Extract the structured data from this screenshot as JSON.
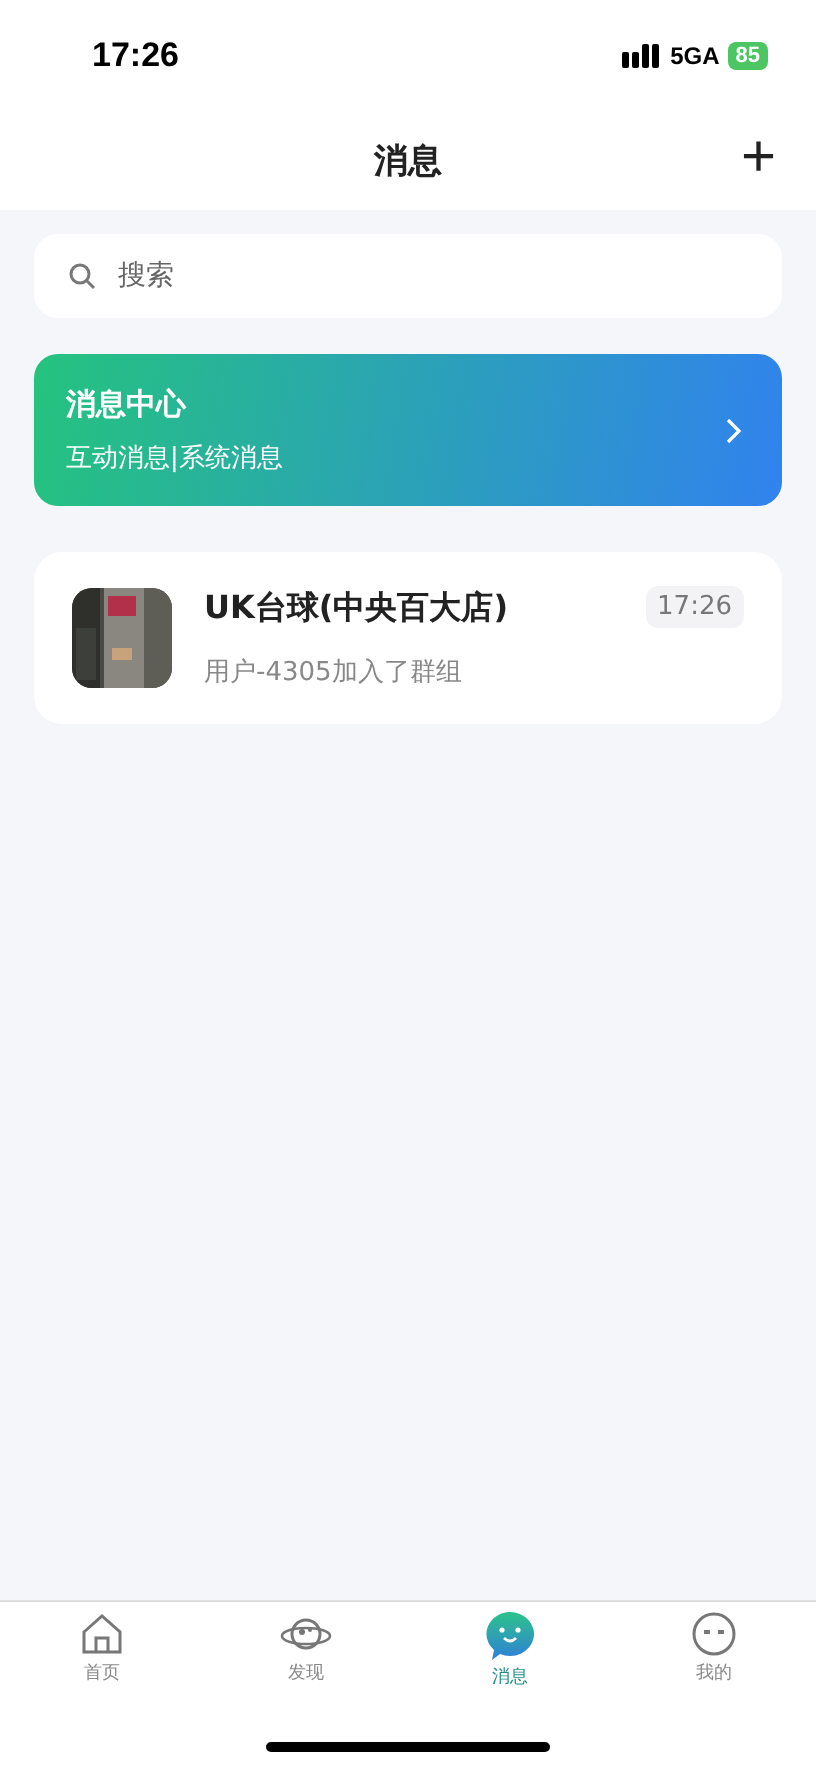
{
  "status_bar": {
    "time": "17:26",
    "network": "5GA",
    "battery": "85"
  },
  "nav": {
    "title": "消息",
    "add": "+"
  },
  "search": {
    "placeholder": "搜索"
  },
  "message_center": {
    "title": "消息中心",
    "subtitle": "互动消息|系统消息"
  },
  "chats": [
    {
      "name": "UK台球(中央百大店)",
      "preview": "用户-4305加入了群组",
      "time": "17:26"
    }
  ],
  "tabs": [
    {
      "kind": "home",
      "label": "首页",
      "selected": false
    },
    {
      "kind": "discover",
      "label": "发现",
      "selected": false
    },
    {
      "kind": "messages",
      "label": "消息",
      "selected": true
    },
    {
      "kind": "profile",
      "label": "我的",
      "selected": false
    }
  ]
}
